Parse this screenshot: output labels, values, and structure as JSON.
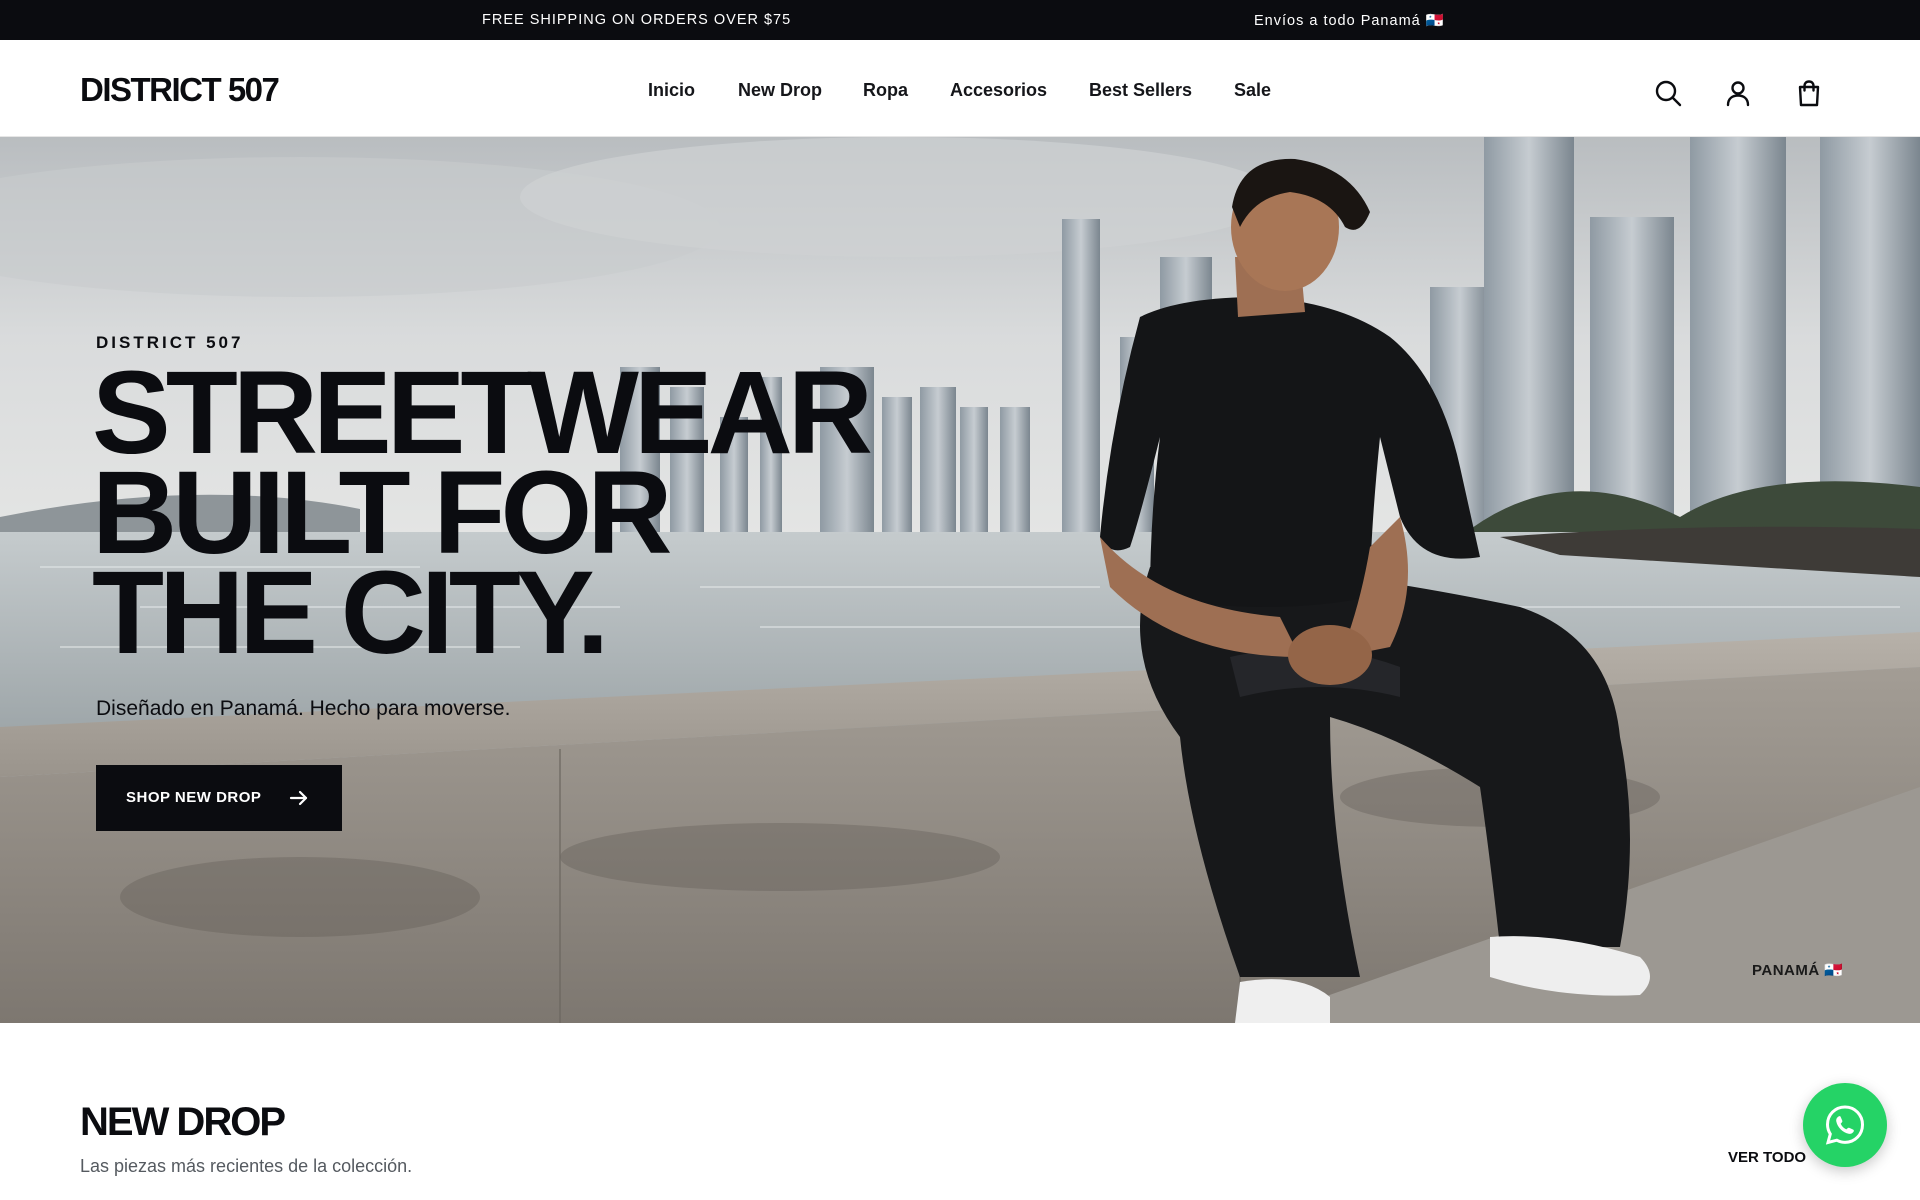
{
  "announcement": {
    "left": "FREE SHIPPING ON ORDERS OVER $75",
    "right": "Envíos a todo Panamá 🇵🇦"
  },
  "header": {
    "logo": "DISTRICT 507",
    "nav": [
      "Inicio",
      "New Drop",
      "Ropa",
      "Accesorios",
      "Best Sellers",
      "Sale"
    ],
    "active_nav": "Inicio",
    "icons": [
      "search-icon",
      "account-icon",
      "cart-icon"
    ]
  },
  "hero": {
    "eyebrow": "DISTRICT 507",
    "headline": [
      "STREETWEAR",
      "BUILT FOR",
      "THE CITY."
    ],
    "subline": "Diseñado en Panamá. Hecho para moverse.",
    "cta_label": "SHOP NEW DROP",
    "location_tag": "PANAMÁ 🇵🇦"
  },
  "section": {
    "title": "NEW DROP",
    "subtitle": "Las piezas más recientes de la colección.",
    "see_all": "VER TODO"
  },
  "colors": {
    "dark": "#0b0c10",
    "white": "#ffffff",
    "whatsapp": "#25d366",
    "muted_text": "#555a60"
  },
  "floating": {
    "icon": "whatsapp-icon"
  }
}
